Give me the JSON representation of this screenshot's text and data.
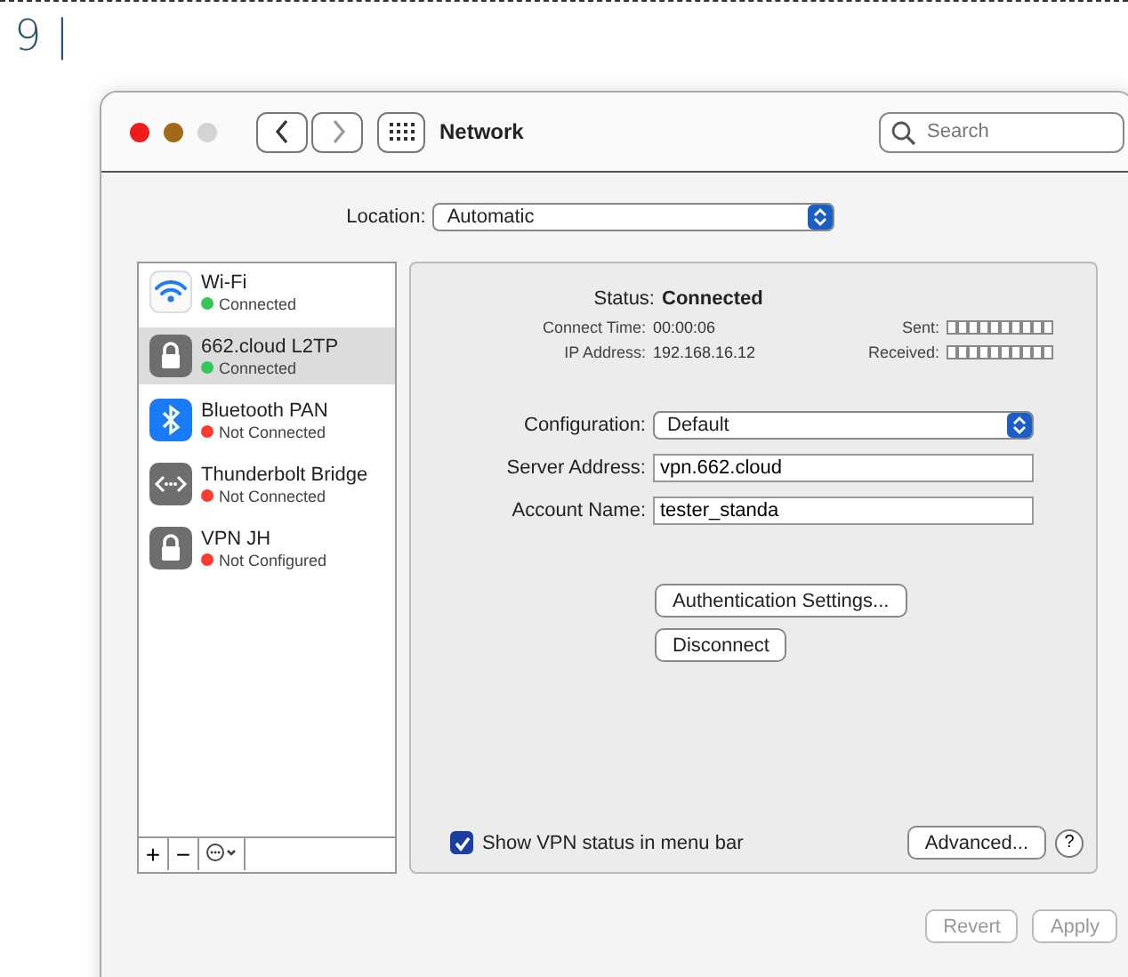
{
  "page_marker": "9 |",
  "window": {
    "title": "Network",
    "search": {
      "placeholder": "Search"
    }
  },
  "location": {
    "label": "Location:",
    "value": "Automatic"
  },
  "services": [
    {
      "kind": "wifi",
      "name": "Wi-Fi",
      "status": "Connected",
      "color": "#34c759",
      "selected": false
    },
    {
      "kind": "lock",
      "name": "662.cloud L2TP",
      "status": "Connected",
      "color": "#34c759",
      "selected": true
    },
    {
      "kind": "bluetooth",
      "name": "Bluetooth PAN",
      "status": "Not Connected",
      "color": "#ff3b30",
      "selected": false
    },
    {
      "kind": "bridge",
      "name": "Thunderbolt Bridge",
      "status": "Not Connected",
      "color": "#ff3b30",
      "selected": false
    },
    {
      "kind": "lock",
      "name": "VPN JH",
      "status": "Not Configured",
      "color": "#ff3b30",
      "selected": false
    }
  ],
  "detail": {
    "status_label": "Status:",
    "status": "Connected",
    "stats": [
      {
        "label": "Connect Time:",
        "value": "00:00:06"
      },
      {
        "label": "IP Address:",
        "value": "192.168.16.12"
      }
    ],
    "meters": [
      {
        "label": "Sent:"
      },
      {
        "label": "Received:"
      }
    ],
    "configuration": {
      "label": "Configuration:",
      "value": "Default"
    },
    "fields": [
      {
        "label": "Server Address:",
        "value": "vpn.662.cloud"
      },
      {
        "label": "Account Name:",
        "value": "tester_standa"
      }
    ],
    "buttons": [
      "Authentication Settings...",
      "Disconnect"
    ],
    "show_status": {
      "label": "Show VPN status in menu bar",
      "checked": true
    },
    "advanced": "Advanced...",
    "help": "?"
  },
  "list_tools": [
    "+",
    "−"
  ],
  "footer_buttons": [
    {
      "label": "Revert",
      "disabled": true
    },
    {
      "label": "Apply",
      "disabled": true
    }
  ]
}
